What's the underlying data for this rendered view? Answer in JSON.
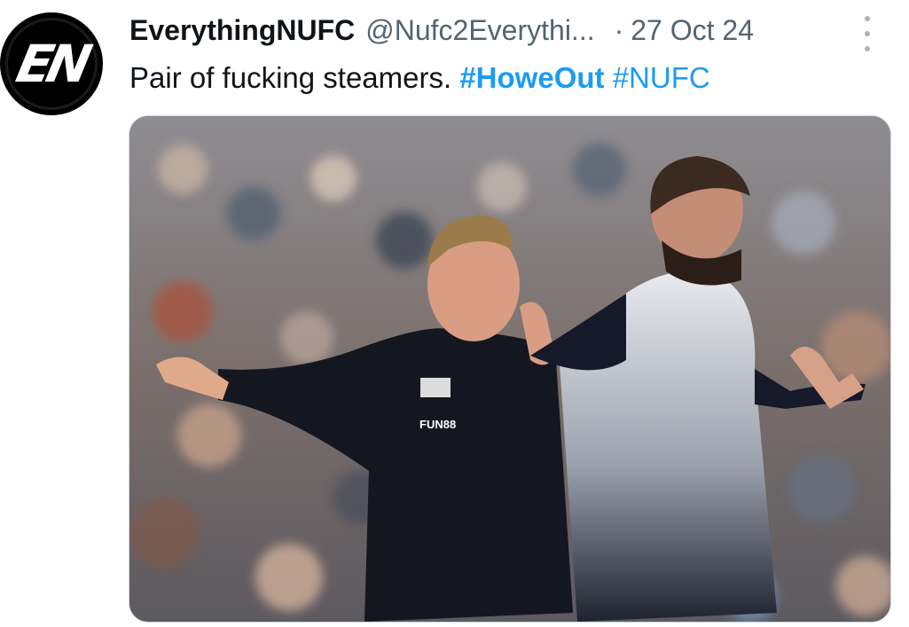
{
  "tweet": {
    "avatar_text": "EN",
    "display_name": "EverythingNUFC",
    "handle": "@Nufc2Everythi...",
    "separator": "·",
    "date": "27 Oct 24",
    "text": "Pair of fucking steamers. ",
    "hashtags": [
      "#HoweOut",
      "#NUFC"
    ],
    "media": {
      "kit_text": [
        "FUN88"
      ]
    }
  },
  "colors": {
    "hashtag": "#1d9bf0",
    "secondary_text": "#536471",
    "primary_text": "#0f1419"
  },
  "icons": {
    "more": "more-vertical-icon"
  }
}
